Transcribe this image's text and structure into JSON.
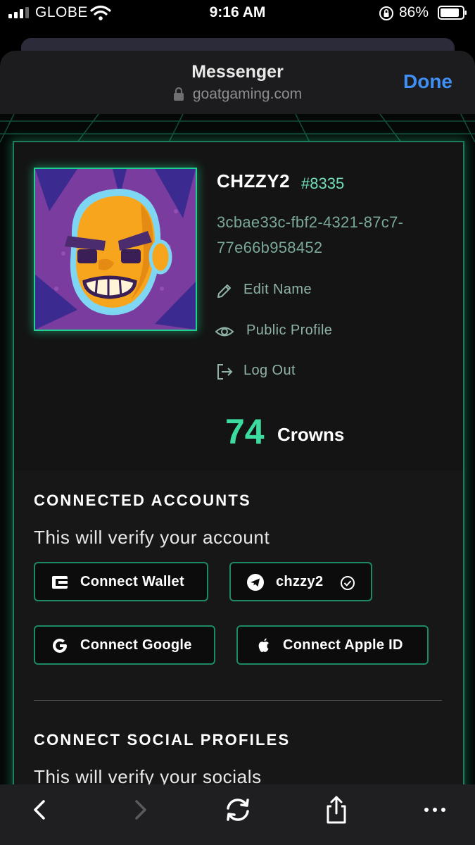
{
  "status_bar": {
    "carrier": "GLOBE",
    "time": "9:16 AM",
    "battery_percent": "86%",
    "icons": [
      "signal-icon",
      "wifi-icon",
      "orientation-lock-icon",
      "battery-icon"
    ]
  },
  "browser": {
    "title": "Messenger",
    "url": "goatgaming.com",
    "done_label": "Done"
  },
  "profile": {
    "username": "CHZZY2",
    "tag": "#8335",
    "uuid": "3cbae33c-fbf2-4321-87c7-77e66b958452",
    "menu": [
      {
        "label": "Edit Name",
        "icon": "pencil-icon"
      },
      {
        "label": "Public Profile",
        "icon": "eye-icon"
      },
      {
        "label": "Log Out",
        "icon": "logout-icon"
      }
    ],
    "crowns_count": "74",
    "crowns_label": "Crowns"
  },
  "connected_accounts": {
    "title": "CONNECTED ACCOUNTS",
    "subtitle": "This will verify your account",
    "buttons": [
      {
        "label": "Connect Wallet",
        "icon": "wallet-icon"
      },
      {
        "label": "chzzy2",
        "icon": "telegram-icon",
        "verified_icon": "check-circle-icon"
      },
      {
        "label": "Connect Google",
        "icon": "google-icon"
      },
      {
        "label": "Connect Apple ID",
        "icon": "apple-icon"
      }
    ]
  },
  "social_profiles": {
    "title": "CONNECT SOCIAL PROFILES",
    "subtitle": "This will verify your socials"
  },
  "toolbar": {
    "icons": [
      "back-icon",
      "forward-icon",
      "reload-icon",
      "share-icon",
      "more-icon"
    ]
  },
  "colors": {
    "accent_green": "#3cdca0",
    "panel_border": "#1f7d5c",
    "link_blue": "#3f8ff5"
  }
}
